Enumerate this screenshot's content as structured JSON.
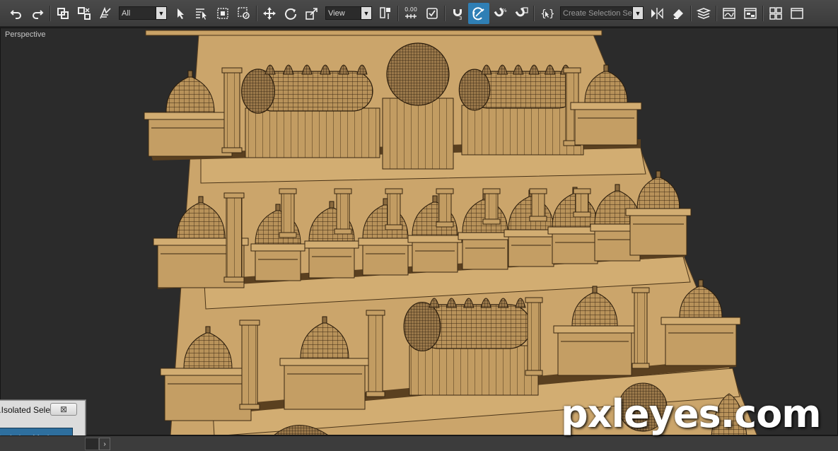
{
  "toolbar": {
    "filter_dropdown": "All",
    "coord_dropdown": "View",
    "snap_value": "0.00",
    "selection_set_placeholder": "Create Selection Se"
  },
  "viewport": {
    "label": "Perspective"
  },
  "panel": {
    "title": "Isolated Sele...",
    "close_glyph": "⊠",
    "mode_button": "Isolation Mode"
  },
  "bottombar": {
    "scroll_right": "›"
  },
  "watermark": "pxleyes.com",
  "colors": {
    "toolbar_bg": "#424242",
    "viewport_bg": "#2b2b2b",
    "model_face": "#c8a46a",
    "model_shadow": "#8a6a3e",
    "wire": "#2a1e10",
    "accent": "#2f7fb5"
  },
  "icons": [
    "undo-icon",
    "redo-icon",
    "select-link-icon",
    "unlink-icon",
    "bind-warp-icon",
    "select-object-icon",
    "select-by-name-icon",
    "rect-region-icon",
    "window-crossing-icon",
    "move-icon",
    "rotate-icon",
    "scale-icon",
    "pivot-icon",
    "snap-toggle-icon",
    "spinner-snap-icon",
    "keyboard-shortcut-icon",
    "snap-3d-icon",
    "angle-snap-icon",
    "percent-snap-icon",
    "edit-named-sets-icon",
    "mirror-icon",
    "align-icon",
    "layer-icon",
    "curve-editor-icon",
    "schematic-icon",
    "material-editor-icon"
  ]
}
